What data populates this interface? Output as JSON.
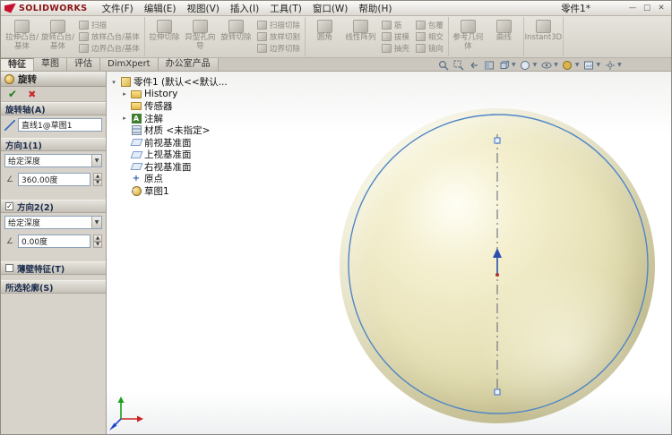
{
  "titlebar": {
    "app": "SOLIDWORKS",
    "doc": "零件1*"
  },
  "menubar": {
    "items": [
      "文件(F)",
      "编辑(E)",
      "视图(V)",
      "插入(I)",
      "工具(T)",
      "窗口(W)",
      "帮助(H)"
    ]
  },
  "ribbon": {
    "buttons": {
      "extrude_boss": "拉伸凸台/基体",
      "revolve_boss": "旋转凸台/基体",
      "sweep": "扫描",
      "loft": "放样凸台/基体",
      "boundary": "边界凸台/基体",
      "extrude_cut": "拉伸切除",
      "hole_wizard": "异型孔向导",
      "revolve_cut": "旋转切除",
      "sweep_cut": "扫描切除",
      "loft_cut": "放样切割",
      "boundary_cut": "边界切除",
      "fillet": "圆角",
      "linear_pattern": "线性阵列",
      "rib": "筋",
      "draft": "拔模",
      "shell": "抽壳",
      "wrap": "包覆",
      "intersect": "相交",
      "mirror": "镜向",
      "reference_geometry": "参考几何体",
      "curves": "曲线",
      "instant3d": "Instant3D"
    }
  },
  "tabs": {
    "items": [
      "特征",
      "草图",
      "评估",
      "DimXpert",
      "办公室产品"
    ],
    "active": "特征"
  },
  "headsup": {
    "icons": [
      "zoom-fit",
      "zoom-to-area",
      "previous-view",
      "section-view",
      "view-orientation",
      "display-style",
      "hide-show-items",
      "edit-appearance",
      "apply-scene",
      "view-settings"
    ]
  },
  "pm": {
    "title": "旋转",
    "axis_label": "旋转轴(A)",
    "axis_value": "直线1@草图1",
    "dir1_label": "方向1(1)",
    "dir1_condition": "给定深度",
    "dir1_angle": "360.00度",
    "dir2_label": "方向2(2)",
    "dir2_checked": true,
    "dir2_condition": "给定深度",
    "dir2_angle": "0.00度",
    "thin_label": "薄壁特征(T)",
    "contours_label": "所选轮廓(S)"
  },
  "feature_tree": {
    "root": "零件1 (默认<<默认...",
    "items": [
      "History",
      "传感器",
      "注解",
      "材质 <未指定>",
      "前视基准面",
      "上视基准面",
      "右视基准面",
      "原点",
      "草图1"
    ]
  },
  "icons": {
    "ok": "✔",
    "cancel": "✖",
    "dropdown": "▼",
    "spin_up": "▲",
    "spin_down": "▼",
    "check": "✓",
    "expand": "▸",
    "collapse": "▾",
    "angle": "∠",
    "minimize": "—",
    "maximize": "□",
    "close": "✕"
  },
  "colors": {
    "accent_blue": "#3a6fc0",
    "sphere_base": "#e7e2b8",
    "check_green": "#1e7d1e",
    "cross_red": "#c92a2a",
    "logo_red": "#c8102e"
  }
}
